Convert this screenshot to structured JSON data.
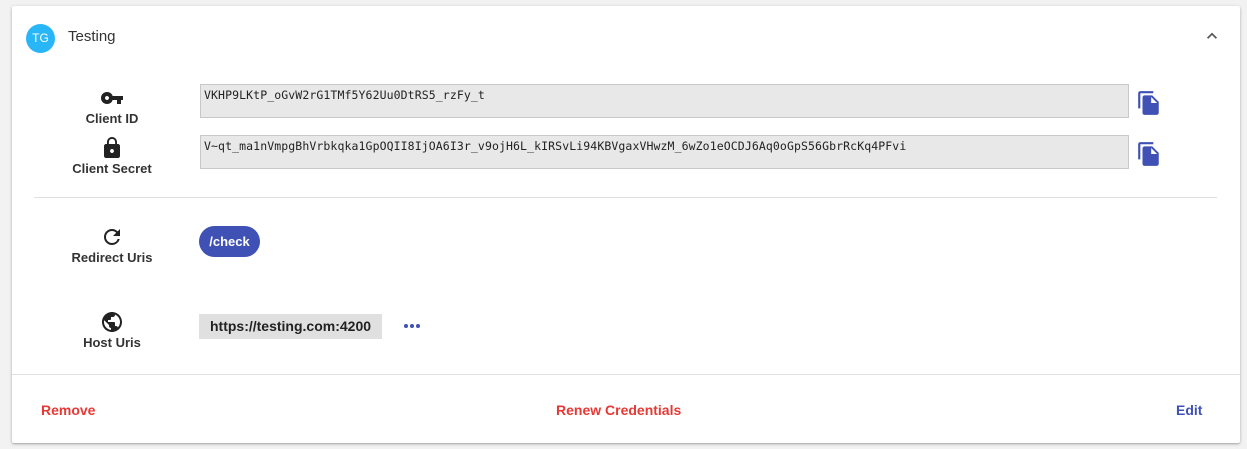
{
  "header": {
    "avatar_initials": "TG",
    "title": "Testing",
    "collapse_icon": "chevron-up-icon"
  },
  "credentials": {
    "client_id": {
      "label": "Client ID",
      "icon": "key-icon",
      "value": "VKHP9LKtP_oGvW2rG1TMf5Y62Uu0DtRS5_rzFy_t"
    },
    "client_secret": {
      "label": "Client Secret",
      "icon": "lock-icon",
      "value": "V~qt_ma1nVmpgBhVrbkqka1GpOQII8IjOA6I3r_v9ojH6L_kIRSvLi94KBVgaxVHwzM_6wZo1eOCDJ6Aq0oGpS56GbrRcKq4PFvi"
    },
    "copy_icon": "copy-icon"
  },
  "redirect": {
    "label": "Redirect Uris",
    "icon": "refresh-icon",
    "uris": [
      "/check"
    ]
  },
  "host": {
    "label": "Host Uris",
    "icon": "globe-icon",
    "uris": [
      "https://testing.com:4200"
    ],
    "more_icon": "more-horizontal-icon"
  },
  "actions": {
    "remove": "Remove",
    "renew": "Renew Credentials",
    "edit": "Edit"
  },
  "colors": {
    "accent": "#3f51b5",
    "danger": "#e53935",
    "avatar": "#29b6f6",
    "primary_text": "#333333"
  }
}
